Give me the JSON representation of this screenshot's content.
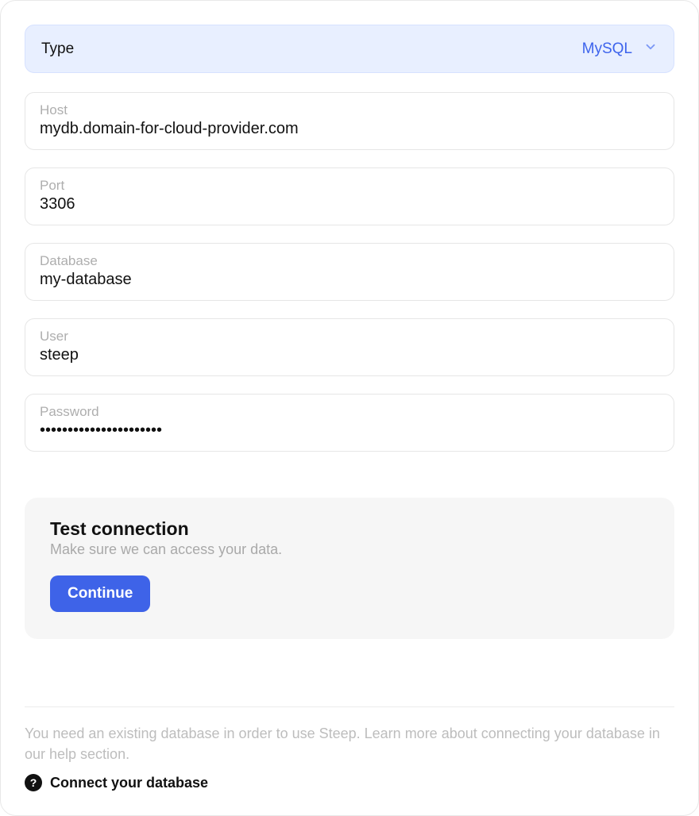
{
  "type_field": {
    "label": "Type",
    "value": "MySQL"
  },
  "fields": {
    "host": {
      "label": "Host",
      "value": "mydb.domain-for-cloud-provider.com"
    },
    "port": {
      "label": "Port",
      "value": "3306"
    },
    "database": {
      "label": "Database",
      "value": "my-database"
    },
    "user": {
      "label": "User",
      "value": "steep"
    },
    "password": {
      "label": "Password",
      "value": "••••••••••••••••••••••"
    }
  },
  "test": {
    "title": "Test connection",
    "subtitle": "Make sure we can access your data.",
    "button": "Continue"
  },
  "footer": {
    "info": "You need an existing database in order to use Steep. Learn more about connecting your database in our help section.",
    "link": "Connect your database"
  }
}
